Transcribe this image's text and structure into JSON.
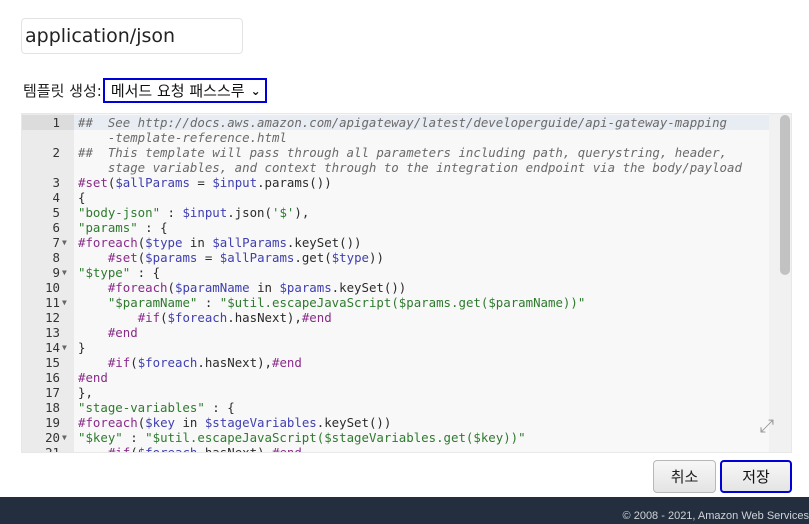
{
  "content_type": "application/json",
  "template": {
    "label": "템플릿 생성:",
    "selected": "메서드 요청 패스스루",
    "chevron_icon": "chevron-down-icon"
  },
  "editor": {
    "lines": [
      {
        "num": "1",
        "fold": "",
        "segs": [
          [
            "c",
            "##  See http://docs.aws.amazon.com/apigateway/latest/developerguide/api-gateway-mapping"
          ]
        ],
        "active": true
      },
      {
        "num": "",
        "fold": "",
        "segs": [
          [
            "c",
            "    -template-reference.html"
          ]
        ]
      },
      {
        "num": "2",
        "fold": "",
        "segs": [
          [
            "c",
            "##  This template will pass through all parameters including path, querystring, header,"
          ]
        ]
      },
      {
        "num": "",
        "fold": "",
        "segs": [
          [
            "c",
            "    stage variables, and context through to the integration endpoint via the body/payload"
          ]
        ]
      },
      {
        "num": "3",
        "fold": "",
        "segs": [
          [
            "k",
            "#set"
          ],
          [
            "t",
            "("
          ],
          [
            "v",
            "$allParams"
          ],
          [
            "t",
            " = "
          ],
          [
            "v",
            "$input"
          ],
          [
            "t",
            ".params())"
          ]
        ]
      },
      {
        "num": "4",
        "fold": "",
        "segs": [
          [
            "t",
            "{"
          ]
        ]
      },
      {
        "num": "5",
        "fold": "",
        "segs": [
          [
            "s",
            "\"body-json\""
          ],
          [
            "t",
            " : "
          ],
          [
            "v",
            "$input"
          ],
          [
            "t",
            ".json("
          ],
          [
            "s",
            "'$'"
          ],
          [
            "t",
            "),"
          ]
        ]
      },
      {
        "num": "6",
        "fold": "",
        "segs": [
          [
            "s",
            "\"params\""
          ],
          [
            "t",
            " : {"
          ]
        ]
      },
      {
        "num": "7",
        "fold": "▼",
        "segs": [
          [
            "k",
            "#foreach"
          ],
          [
            "t",
            "("
          ],
          [
            "v",
            "$type"
          ],
          [
            "t",
            " in "
          ],
          [
            "v",
            "$allParams"
          ],
          [
            "t",
            ".keySet())"
          ]
        ]
      },
      {
        "num": "8",
        "fold": "",
        "segs": [
          [
            "t",
            "    "
          ],
          [
            "k",
            "#set"
          ],
          [
            "t",
            "("
          ],
          [
            "v",
            "$params"
          ],
          [
            "t",
            " = "
          ],
          [
            "v",
            "$allParams"
          ],
          [
            "t",
            ".get("
          ],
          [
            "v",
            "$type"
          ],
          [
            "t",
            "))"
          ]
        ]
      },
      {
        "num": "9",
        "fold": "▼",
        "segs": [
          [
            "s",
            "\"$type\""
          ],
          [
            "t",
            " : {"
          ]
        ]
      },
      {
        "num": "10",
        "fold": "",
        "segs": [
          [
            "t",
            "    "
          ],
          [
            "k",
            "#foreach"
          ],
          [
            "t",
            "("
          ],
          [
            "v",
            "$paramName"
          ],
          [
            "t",
            " in "
          ],
          [
            "v",
            "$params"
          ],
          [
            "t",
            ".keySet())"
          ]
        ]
      },
      {
        "num": "11",
        "fold": "▼",
        "segs": [
          [
            "t",
            "    "
          ],
          [
            "s",
            "\"$paramName\""
          ],
          [
            "t",
            " : "
          ],
          [
            "s",
            "\"$util.escapeJavaScript($params.get($paramName))\""
          ]
        ]
      },
      {
        "num": "12",
        "fold": "",
        "segs": [
          [
            "t",
            "        "
          ],
          [
            "k",
            "#if"
          ],
          [
            "t",
            "("
          ],
          [
            "v",
            "$foreach"
          ],
          [
            "t",
            ".hasNext),"
          ],
          [
            "k",
            "#end"
          ]
        ]
      },
      {
        "num": "13",
        "fold": "",
        "segs": [
          [
            "t",
            "    "
          ],
          [
            "k",
            "#end"
          ]
        ]
      },
      {
        "num": "14",
        "fold": "▼",
        "segs": [
          [
            "t",
            "}"
          ]
        ]
      },
      {
        "num": "15",
        "fold": "",
        "segs": [
          [
            "t",
            "    "
          ],
          [
            "k",
            "#if"
          ],
          [
            "t",
            "("
          ],
          [
            "v",
            "$foreach"
          ],
          [
            "t",
            ".hasNext),"
          ],
          [
            "k",
            "#end"
          ]
        ]
      },
      {
        "num": "16",
        "fold": "",
        "segs": [
          [
            "k",
            "#end"
          ]
        ]
      },
      {
        "num": "17",
        "fold": "",
        "segs": [
          [
            "t",
            "},"
          ]
        ]
      },
      {
        "num": "18",
        "fold": "",
        "segs": [
          [
            "s",
            "\"stage-variables\""
          ],
          [
            "t",
            " : {"
          ]
        ]
      },
      {
        "num": "19",
        "fold": "",
        "segs": [
          [
            "k",
            "#foreach"
          ],
          [
            "t",
            "("
          ],
          [
            "v",
            "$key"
          ],
          [
            "t",
            " in "
          ],
          [
            "v",
            "$stageVariables"
          ],
          [
            "t",
            ".keySet())"
          ]
        ]
      },
      {
        "num": "20",
        "fold": "▼",
        "segs": [
          [
            "s",
            "\"$key\""
          ],
          [
            "t",
            " : "
          ],
          [
            "s",
            "\"$util.escapeJavaScript($stageVariables.get($key))\""
          ]
        ]
      },
      {
        "num": "21",
        "fold": "",
        "segs": [
          [
            "t",
            "    "
          ],
          [
            "k",
            "#if"
          ],
          [
            "t",
            "("
          ],
          [
            "v",
            "$foreach"
          ],
          [
            "t",
            ".hasNext),"
          ],
          [
            "k",
            "#end"
          ]
        ]
      }
    ],
    "resize_icon": "expand-diagonal-icon"
  },
  "buttons": {
    "cancel_label": "취소",
    "save_label": "저장"
  },
  "footer": {
    "copyright": "© 2008 - 2021, Amazon Web Services"
  },
  "colors": {
    "focus_outline": "#0000d8",
    "footer_bg": "#232f3e"
  }
}
